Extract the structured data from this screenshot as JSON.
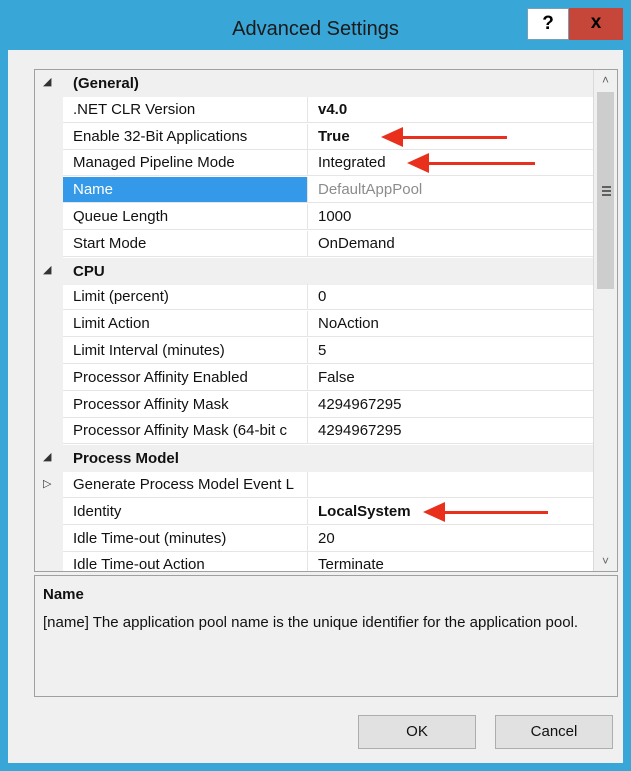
{
  "window": {
    "title": "Advanced Settings",
    "help_label": "?",
    "close_label": "x"
  },
  "properties": [
    {
      "type": "category",
      "glyph": "◢",
      "label": "(General)"
    },
    {
      "type": "prop",
      "name": ".NET CLR Version",
      "value": "v4.0",
      "bold": true
    },
    {
      "type": "prop",
      "name": "Enable 32-Bit Applications",
      "value": "True",
      "bold": true,
      "arrow": true
    },
    {
      "type": "prop",
      "name": "Managed Pipeline Mode",
      "value": "Integrated",
      "arrow": true
    },
    {
      "type": "prop",
      "name": "Name",
      "value": "DefaultAppPool",
      "selected": true,
      "gray": true
    },
    {
      "type": "prop",
      "name": "Queue Length",
      "value": "1000"
    },
    {
      "type": "prop",
      "name": "Start Mode",
      "value": "OnDemand"
    },
    {
      "type": "category",
      "glyph": "◢",
      "label": "CPU"
    },
    {
      "type": "prop",
      "name": "Limit (percent)",
      "value": "0"
    },
    {
      "type": "prop",
      "name": "Limit Action",
      "value": "NoAction"
    },
    {
      "type": "prop",
      "name": "Limit Interval (minutes)",
      "value": "5"
    },
    {
      "type": "prop",
      "name": "Processor Affinity Enabled",
      "value": "False"
    },
    {
      "type": "prop",
      "name": "Processor Affinity Mask",
      "value": "4294967295"
    },
    {
      "type": "prop",
      "name": "Processor Affinity Mask (64-bit c",
      "value": "4294967295"
    },
    {
      "type": "category",
      "glyph": "◢",
      "label": "Process Model"
    },
    {
      "type": "prop",
      "name": "Generate Process Model Event L",
      "value": "",
      "expand": "▷"
    },
    {
      "type": "prop",
      "name": "Identity",
      "value": "LocalSystem",
      "bold": true,
      "arrow": true
    },
    {
      "type": "prop",
      "name": "Idle Time-out (minutes)",
      "value": "20"
    },
    {
      "type": "prop",
      "name": "Idle Time-out Action",
      "value": "Terminate"
    }
  ],
  "scrollbar": {
    "up": "˄",
    "down": "˅"
  },
  "description": {
    "title": "Name",
    "text": "[name] The application pool name is the unique identifier for the application pool."
  },
  "buttons": {
    "ok": "OK",
    "cancel": "Cancel"
  },
  "colors": {
    "accent": "#39a6d8",
    "selection": "#3399e8",
    "arrow": "#e8301c",
    "close": "#c7463a"
  }
}
